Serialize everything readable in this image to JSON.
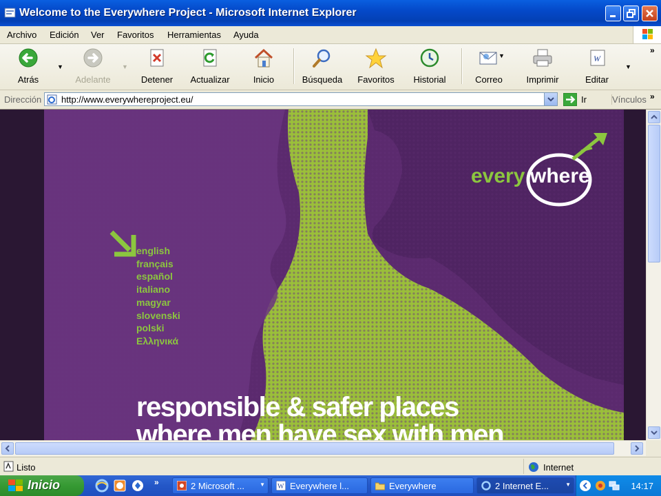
{
  "window": {
    "title": "Welcome to the Everywhere Project - Microsoft Internet Explorer"
  },
  "menu": {
    "items": [
      "Archivo",
      "Edición",
      "Ver",
      "Favoritos",
      "Herramientas",
      "Ayuda"
    ]
  },
  "toolbar": {
    "back_label": "Atrás",
    "forward_label": "Adelante",
    "stop_label": "Detener",
    "refresh_label": "Actualizar",
    "home_label": "Inicio",
    "search_label": "Búsqueda",
    "favorites_label": "Favoritos",
    "history_label": "Historial",
    "mail_label": "Correo",
    "print_label": "Imprimir",
    "edit_label": "Editar",
    "more": "»"
  },
  "address": {
    "label": "Dirección",
    "url": "http://www.everywhereproject.eu/",
    "go_label": "Ir",
    "links_label": "Vínculos"
  },
  "page": {
    "logo_left": "every",
    "logo_right": "where",
    "languages": [
      "english",
      "français",
      "español",
      "italiano",
      "magyar",
      "slovenski",
      "polski",
      "Ελληνικά"
    ],
    "tagline_line1": "responsible & safer places",
    "tagline_line2": "where men have sex with men"
  },
  "status": {
    "text": "Listo",
    "zone": "Internet"
  },
  "taskbar": {
    "start_label": "Inicio",
    "task1": "2 Microsoft ...",
    "task2": "Everywhere l...",
    "task3": "Everywhere",
    "task4": "2 Internet E...",
    "clock": "14:17"
  },
  "colors": {
    "hero_purple": "#5b2a6e",
    "hero_green": "#9bbf3a",
    "logo_green": "#8cc63f",
    "xp_blue": "#0449c9"
  }
}
